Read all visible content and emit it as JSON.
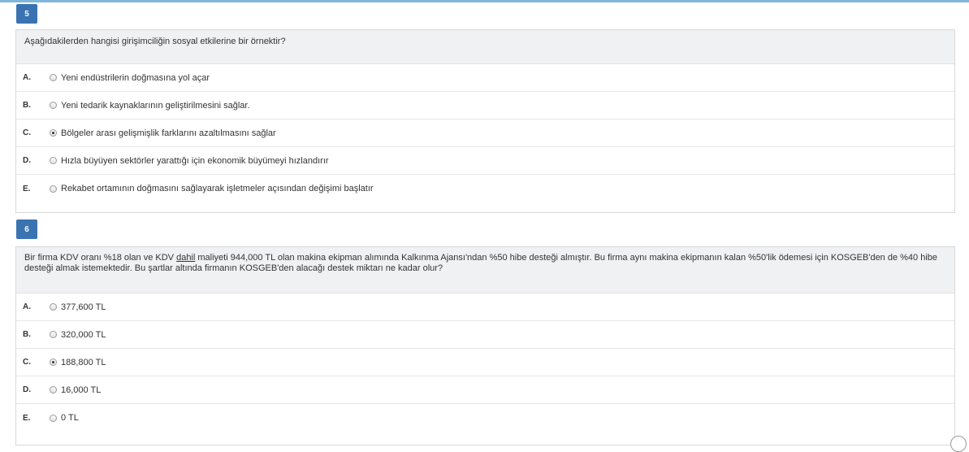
{
  "questions": [
    {
      "number": "5",
      "text_parts": [
        "Aşağıdakilerden hangisi girişimciliğin sosyal etkilerine bir örnektir?"
      ],
      "options": [
        {
          "letter": "A.",
          "text": "Yeni endüstrilerin doğmasına yol açar",
          "selected": false
        },
        {
          "letter": "B.",
          "text": "Yeni tedarik kaynaklarının geliştirilmesini sağlar.",
          "selected": false
        },
        {
          "letter": "C.",
          "text": "Bölgeler arası gelişmişlik farklarını azaltılmasını sağlar",
          "selected": true
        },
        {
          "letter": "D.",
          "text": "Hızla büyüyen sektörler yarattığı için ekonomik büyümeyi hızlandırır",
          "selected": false
        },
        {
          "letter": "E.",
          "text": "Rekabet ortamının doğmasını sağlayarak işletmeler açısından değişimi başlatır",
          "selected": false
        }
      ]
    },
    {
      "number": "6",
      "text_before": "Bir firma KDV oranı %18 olan ve KDV ",
      "text_underlined": "dahil",
      "text_after": " maliyeti 944,000 TL olan makina ekipman alımında Kalkınma Ajansı'ndan %50 hibe desteği almıştır. Bu firma aynı makina ekipmanın kalan %50'lik ödemesi için KOSGEB'den de %40 hibe desteği almak istemektedir. Bu şartlar altında firmanın KOSGEB'den alacağı destek miktarı ne kadar olur?",
      "options": [
        {
          "letter": "A.",
          "text": "377,600 TL",
          "selected": false
        },
        {
          "letter": "B.",
          "text": "320,000 TL",
          "selected": false
        },
        {
          "letter": "C.",
          "text": "188,800 TL",
          "selected": true
        },
        {
          "letter": "D.",
          "text": "16,000 TL",
          "selected": false
        },
        {
          "letter": "E.",
          "text": "0 TL",
          "selected": false
        }
      ]
    }
  ]
}
